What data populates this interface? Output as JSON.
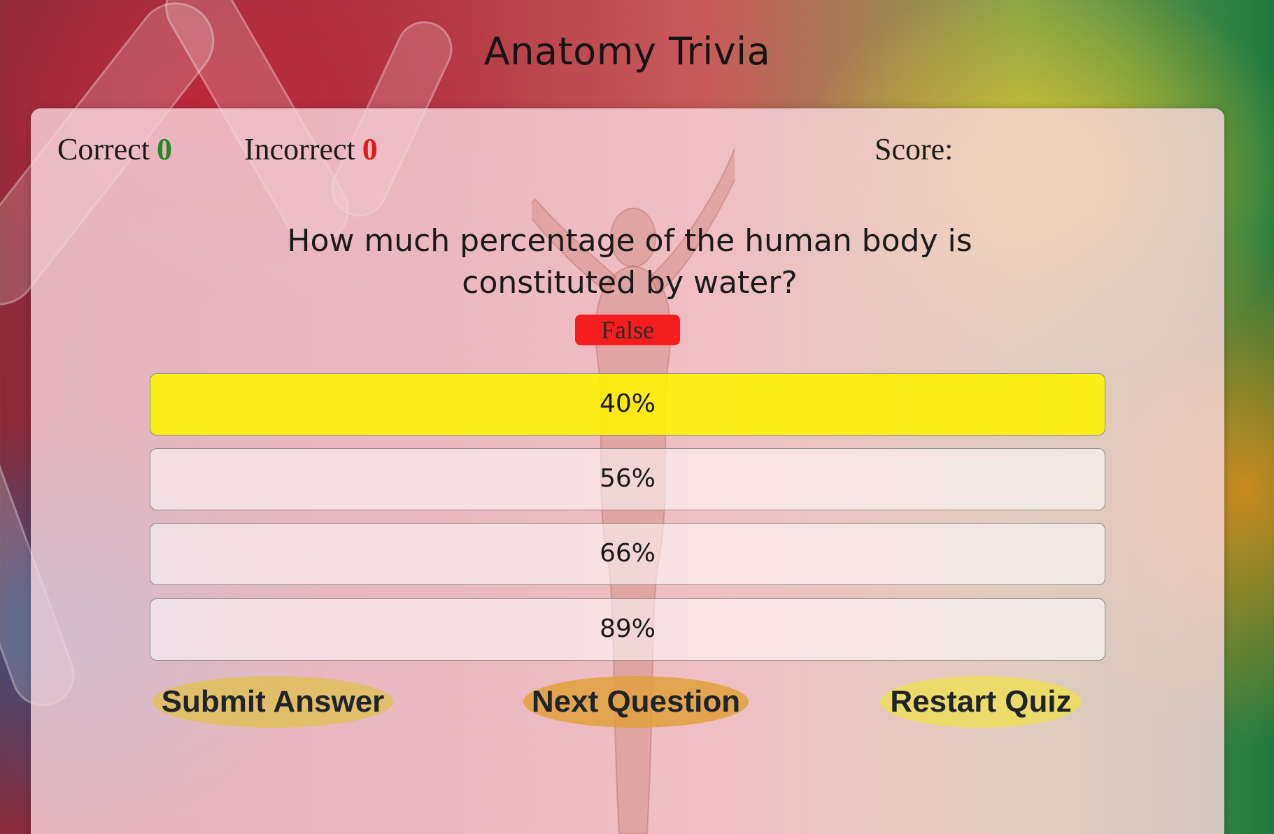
{
  "app": {
    "title": "Anatomy Trivia"
  },
  "stats": {
    "correct_label": "Correct",
    "correct_value": "0",
    "incorrect_label": "Incorrect",
    "incorrect_value": "0",
    "score_label": "Score:"
  },
  "quiz": {
    "question": "How much percentage of the human body is constituted by water?",
    "feedback": "False",
    "answers": [
      {
        "label": "40%",
        "selected": true
      },
      {
        "label": "56%",
        "selected": false
      },
      {
        "label": "66%",
        "selected": false
      },
      {
        "label": "89%",
        "selected": false
      }
    ]
  },
  "actions": {
    "submit_label": "Submit Answer",
    "next_label": "Next Question",
    "restart_label": "Restart Quiz"
  },
  "colors": {
    "correct": "#1f8a2a",
    "incorrect": "#e01b1b",
    "feedback_bg": "#f41e1e",
    "selected_answer": "#fff400"
  }
}
